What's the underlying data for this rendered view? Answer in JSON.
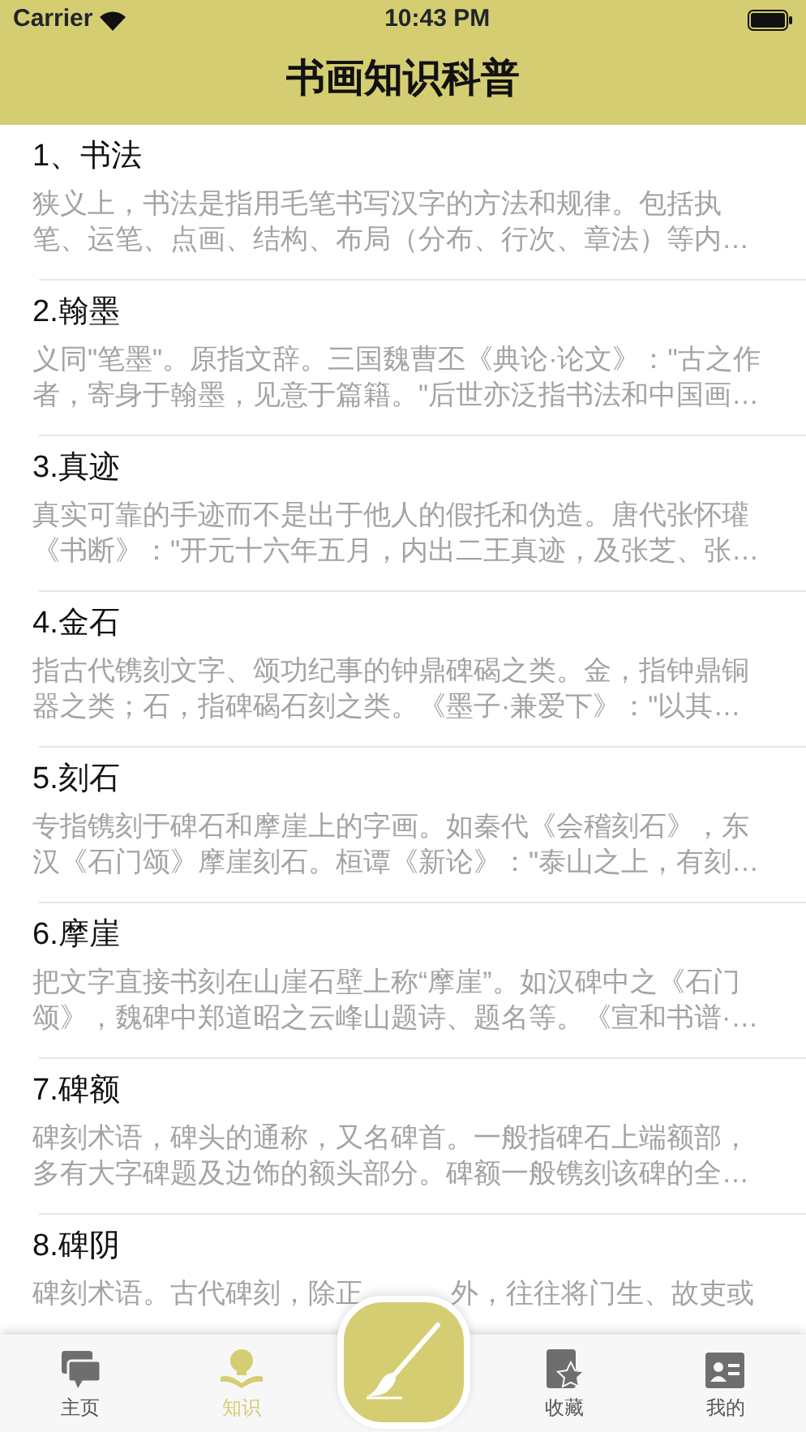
{
  "status_bar": {
    "carrier": "Carrier",
    "time": "10:43 PM"
  },
  "header": {
    "title": "书画知识科普"
  },
  "articles": [
    {
      "title": "1、书法",
      "summary_lines": [
        "狭义上，书法是指用毛笔书写汉字的方法和规律。包括执",
        "笔、运笔、点画、结构、布局（分布、行次、章法）等内…"
      ]
    },
    {
      "title": "2.翰墨",
      "summary_lines": [
        "义同\"笔墨\"。原指文辞。三国魏曹丕《典论·论文》：\"古之作",
        "者，寄身于翰墨，见意于篇籍。\"后世亦泛指书法和中国画…"
      ]
    },
    {
      "title": "3.真迹",
      "summary_lines": [
        "真实可靠的手迹而不是出于他人的假托和伪造。唐代张怀瓘",
        "《书断》：\"开元十六年五月，内出二王真迹，及张芝、张…"
      ]
    },
    {
      "title": "4.金石",
      "summary_lines": [
        "指古代镌刻文字、颂功纪事的钟鼎碑碣之类。金，指钟鼎铜",
        "器之类；石，指碑碣石刻之类。《墨子·兼爱下》：\"以其…"
      ]
    },
    {
      "title": "5.刻石",
      "summary_lines": [
        "专指镌刻于碑石和摩崖上的字画。如秦代《会稽刻石》，东",
        "汉《石门颂》摩崖刻石。桓谭《新论》：\"泰山之上，有刻…"
      ]
    },
    {
      "title": "6.摩崖",
      "summary_lines": [
        "把文字直接书刻在山崖石壁上称“摩崖”。如汉碑中之《石门",
        "颂》，魏碑中郑道昭之云峰山题诗、题名等。《宣和书谱·…"
      ]
    },
    {
      "title": "7.碑额",
      "summary_lines": [
        "碑刻术语，碑头的通称，又名碑首。一般指碑石上端额部，",
        "多有大字碑题及边饰的额头部分。碑额一般镌刻该碑的全…"
      ]
    },
    {
      "title": "8.碑阴",
      "summary_parts": [
        "碑刻术语。古代碑刻，除正",
        "外，往往将门生、故吏或"
      ]
    }
  ],
  "tab_bar": [
    {
      "kind": "home",
      "label": "主页",
      "selected": false
    },
    {
      "kind": "knowledge",
      "label": "知识",
      "selected": true
    },
    {
      "kind": "brush",
      "selected": false
    },
    {
      "kind": "favorites",
      "label": "收藏",
      "selected": false
    },
    {
      "kind": "profile",
      "label": "我的",
      "selected": false
    }
  ]
}
